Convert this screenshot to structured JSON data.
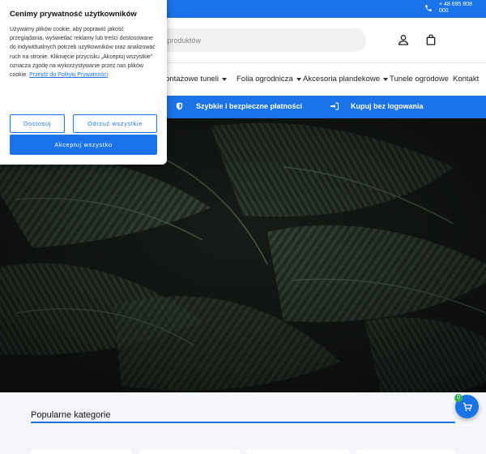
{
  "topbar": {
    "phone": "+ 48 695 808 000"
  },
  "search": {
    "placeholder": "j produktów"
  },
  "nav": {
    "items": [
      {
        "label": "ontażowe tuneli",
        "caret": true
      },
      {
        "label": "Folia ogrodnicza",
        "caret": true
      },
      {
        "label": "Akcesoria plandekowe",
        "caret": true
      },
      {
        "label": "Tunele ogrodowe",
        "caret": false
      },
      {
        "label": "Kontakt",
        "caret": false
      }
    ]
  },
  "features": {
    "payments": "Szybkie i bezpieczne płatności",
    "guest": "Kupuj bez logowania"
  },
  "categories": {
    "title": "Popularne kategorie"
  },
  "cart": {
    "count": "0"
  },
  "cookie": {
    "title": "Cenimy prywatność użytkowników",
    "body": "Używamy plików cookie, aby poprawić jakość przeglądania, wyświetlać reklamy lub treści dostosowane do indywidualnych potrzeb użytkowników oraz analizować ruch na stronie. Kliknięcie przycisku „Akceptuj wszystkie” oznacza zgodę na wykorzystywanie przez nas plików cookie.",
    "policy_link": "Przejdź do Polityki Prywatności",
    "customize": "Dostosuj",
    "reject": "Odrzuć wszystkie",
    "accept": "Akceptuj wszystko"
  },
  "colors": {
    "accent": "#1a73e8",
    "hero": "#1c211d",
    "badge": "#35b34a"
  }
}
